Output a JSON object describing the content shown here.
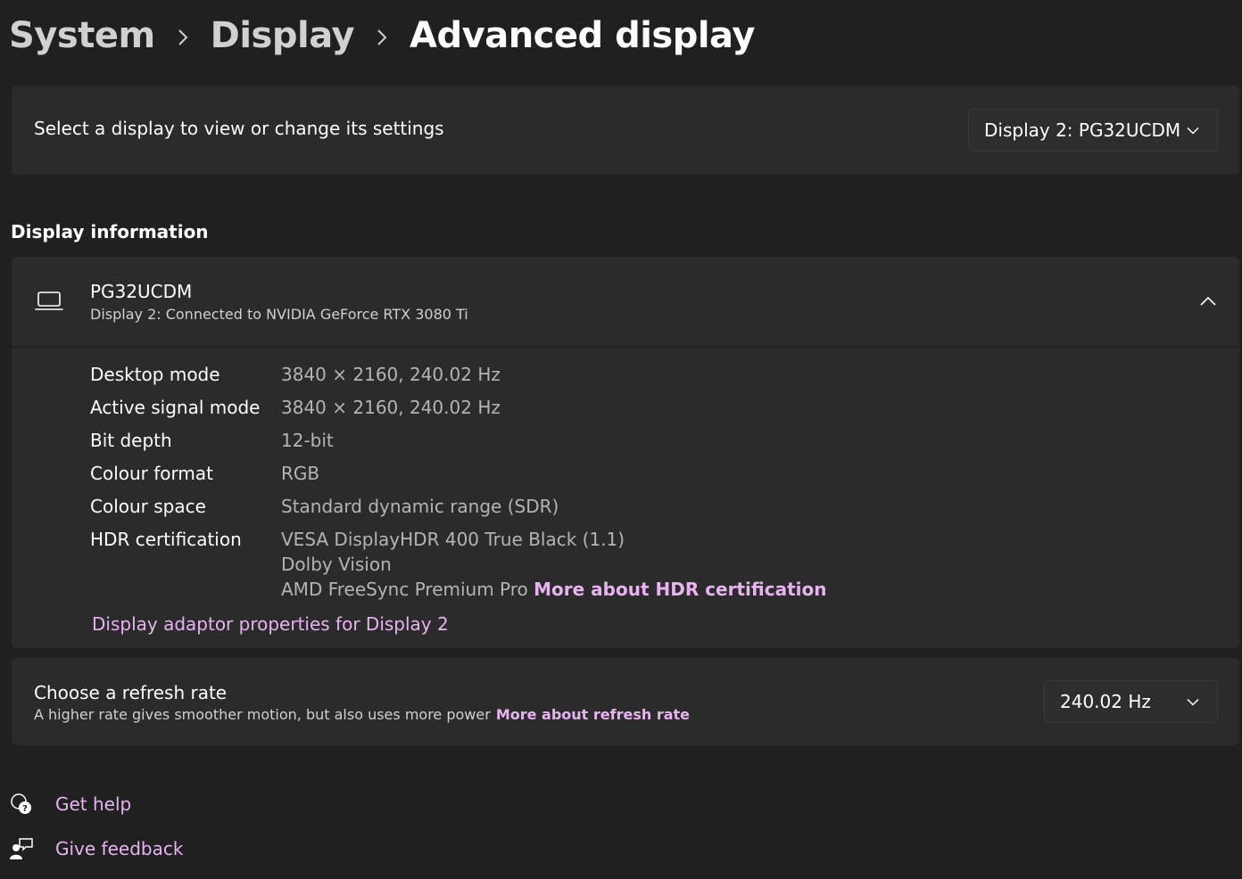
{
  "breadcrumb": {
    "items": [
      "System",
      "Display"
    ],
    "current": "Advanced display"
  },
  "display_select": {
    "label": "Select a display to view or change its settings",
    "selected": "Display 2: PG32UCDM"
  },
  "display_information": {
    "section_title": "Display information",
    "monitor_name": "PG32UCDM",
    "connection": "Display 2: Connected to NVIDIA GeForce RTX 3080 Ti",
    "rows": [
      {
        "label": "Desktop mode",
        "value": "3840 × 2160, 240.02 Hz"
      },
      {
        "label": "Active signal mode",
        "value": "3840 × 2160, 240.02 Hz"
      },
      {
        "label": "Bit depth",
        "value": "12-bit"
      },
      {
        "label": "Colour format",
        "value": "RGB"
      },
      {
        "label": "Colour space",
        "value": "Standard dynamic range (SDR)"
      }
    ],
    "hdr": {
      "label": "HDR certification",
      "values": [
        "VESA DisplayHDR 400 True Black (1.1)",
        "Dolby Vision",
        "AMD FreeSync Premium Pro"
      ],
      "link": "More about HDR certification"
    },
    "adaptor_link": "Display adaptor properties for Display 2"
  },
  "refresh_rate": {
    "title": "Choose a refresh rate",
    "description": "A higher rate gives smoother motion, but also uses more power",
    "link": "More about refresh rate",
    "selected": "240.02 Hz"
  },
  "footer": {
    "get_help": "Get help",
    "give_feedback": "Give feedback"
  },
  "colors": {
    "background": "#202020",
    "card": "#2b2b2b",
    "accent_link": "#e7b4f0",
    "secondary_text": "#b4b4b4"
  }
}
